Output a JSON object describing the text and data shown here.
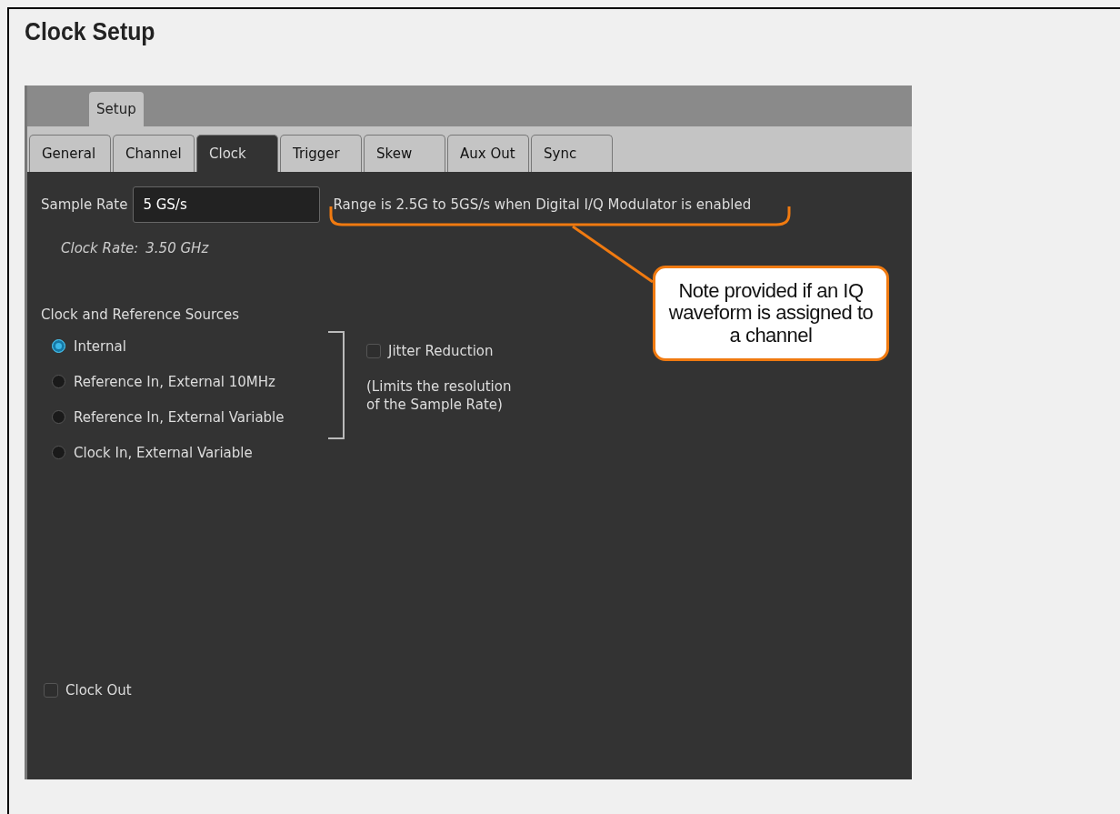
{
  "page_title": "Clock Setup",
  "outer_tabs": [
    {
      "label": "Setup",
      "selected": true
    }
  ],
  "tabs": [
    {
      "label": "General",
      "selected": false
    },
    {
      "label": "Channel",
      "selected": false
    },
    {
      "label": "Clock",
      "selected": true
    },
    {
      "label": "Trigger",
      "selected": false
    },
    {
      "label": "Skew",
      "selected": false
    },
    {
      "label": "Aux Out",
      "selected": false
    },
    {
      "label": "Sync",
      "selected": false
    }
  ],
  "sample_rate": {
    "label": "Sample Rate",
    "value": "5 GS/s",
    "note": "Range is 2.5G to 5GS/s when Digital I/Q Modulator is enabled"
  },
  "clock_rate": {
    "label": "Clock Rate:",
    "value": "3.50 GHz"
  },
  "sources": {
    "title": "Clock and Reference Sources",
    "options": [
      {
        "label": "Internal",
        "selected": true
      },
      {
        "label": "Reference In, External 10MHz",
        "selected": false
      },
      {
        "label": "Reference In, External Variable",
        "selected": false
      },
      {
        "label": "Clock In, External Variable",
        "selected": false
      }
    ]
  },
  "jitter_reduction": {
    "label": "Jitter Reduction",
    "checked": false,
    "note": "(Limits the resolution of the Sample Rate)"
  },
  "clock_out": {
    "label": "Clock Out",
    "checked": false
  },
  "callout": {
    "text": "Note provided if an IQ waveform is assigned to a channel"
  }
}
